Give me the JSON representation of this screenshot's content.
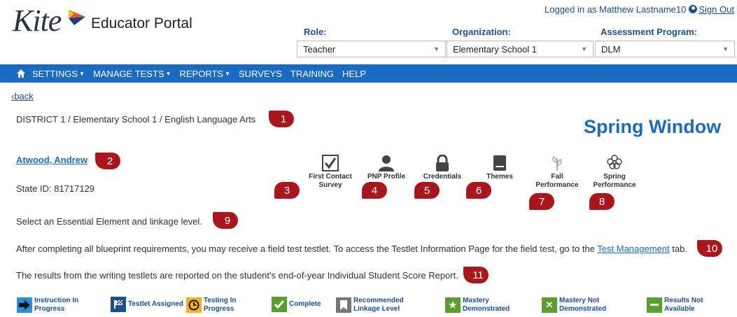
{
  "header": {
    "logo_text": "Kite",
    "portal_title": "Educator Portal",
    "login_text": "Logged in as Matthew Lastname10",
    "sign_out": "Sign Out",
    "role_label": "Role:",
    "role_value": "Teacher",
    "org_label": "Organization:",
    "org_value": "Elementary School 1",
    "ap_label": "Assessment Program:",
    "ap_value": "DLM"
  },
  "nav": {
    "items": [
      "SETTINGS",
      "MANAGE TESTS",
      "REPORTS",
      "SURVEYS",
      "TRAINING",
      "HELP"
    ]
  },
  "main": {
    "back": "‹back",
    "breadcrumb": "DISTRICT 1 / Elementary School 1 / English Language Arts",
    "window_title": "Spring Window",
    "student_name": "Atwood, Andrew",
    "state_id": "State ID: 81717129",
    "select_text": "Select an Essential Element and linkage level.",
    "field_test_text": "After completing all blueprint requirements, you may receive a field test testlet. To access the Testlet Information Page for the field test, go to the",
    "field_test_link": "Test Management",
    "field_test_tail": "tab.",
    "writing_text": "The results from the writing testlets are reported on the student's end-of-year Individual Student Score Report."
  },
  "icons": [
    {
      "label": "First Contact Survey",
      "icon": "checkbox-icon"
    },
    {
      "label": "PNP Profile",
      "icon": "person-icon"
    },
    {
      "label": "Credentials",
      "icon": "lock-icon"
    },
    {
      "label": "Themes",
      "icon": "book-icon"
    },
    {
      "label": "Fall Performance",
      "icon": "leaf-icon"
    },
    {
      "label": "Spring Performance",
      "icon": "flower-icon"
    }
  ],
  "markers": [
    "1",
    "2",
    "3",
    "4",
    "5",
    "6",
    "7",
    "8",
    "9",
    "10",
    "11"
  ],
  "legend": [
    {
      "label": "Instruction In Progress",
      "color": "#2a8fd6"
    },
    {
      "label": "Testlet Assigned",
      "color": "#1c4f8c"
    },
    {
      "label": "Testing In Progress",
      "color": "#f4b021"
    },
    {
      "label": "Complete",
      "color": "#5a9e2f"
    },
    {
      "label": "Recommended Linkage Level",
      "color": "#777777"
    },
    {
      "label": "Mastery Demonstrated",
      "color": "#5a9e2f"
    },
    {
      "label": "Mastery Not Demonstrated",
      "color": "#5a9e2f"
    },
    {
      "label": "Results Not Available",
      "color": "#5a9e2f"
    }
  ]
}
